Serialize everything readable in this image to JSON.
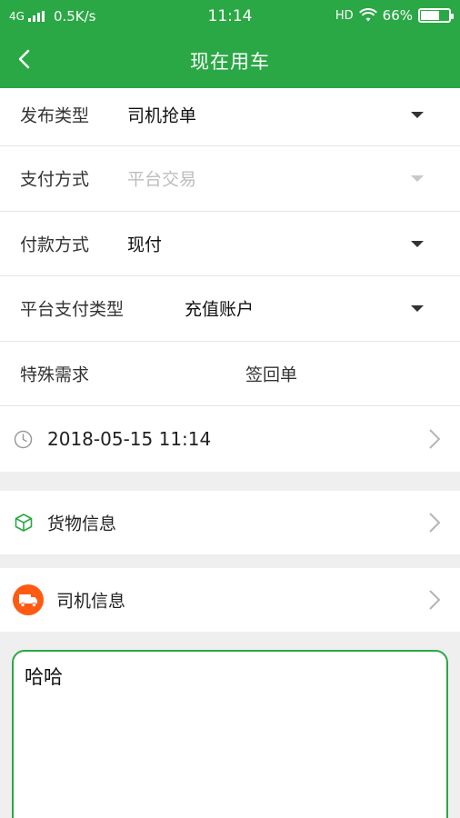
{
  "status_bar": {
    "network": "4G",
    "speed": "0.5K/s",
    "time": "11:14",
    "hd": "HD",
    "battery": "66%",
    "battery_level": 0.66
  },
  "navbar": {
    "title": "现在用车"
  },
  "form": {
    "publish_type": {
      "label": "发布类型",
      "value": "司机抢单"
    },
    "payment_method": {
      "label": "支付方式",
      "value": "平台交易"
    },
    "pay_type": {
      "label": "付款方式",
      "value": "现付"
    },
    "platform_pay_type": {
      "label": "平台支付类型",
      "value": "充值账户"
    },
    "special_needs": {
      "label": "特殊需求",
      "value": "签回单"
    },
    "datetime": {
      "value": "2018-05-15 11:14"
    }
  },
  "sections": {
    "goods_info": "货物信息",
    "driver_info": "司机信息"
  },
  "note": {
    "value": "哈哈"
  },
  "colors": {
    "brand_green": "#2aa845",
    "truck_orange": "#ff5a12"
  }
}
